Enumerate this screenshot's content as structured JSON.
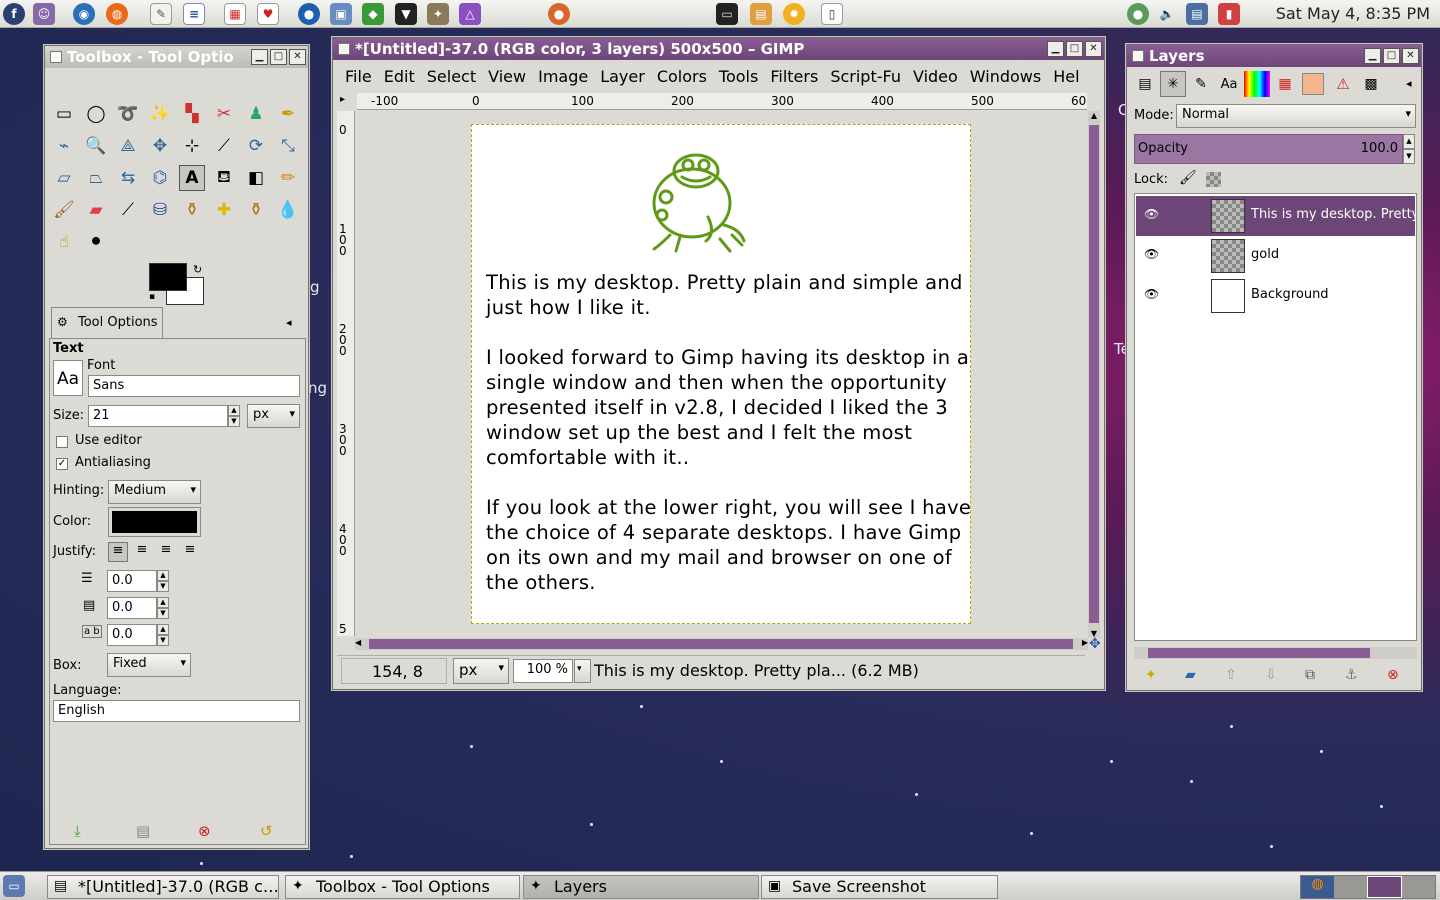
{
  "top_panel": {
    "clock": "Sat May  4,  8:35 PM"
  },
  "taskbar": {
    "items": [
      "*[Untitled]-37.0 (RGB c…",
      "Toolbox - Tool Options",
      "Layers",
      "Save Screenshot"
    ]
  },
  "toolbox": {
    "title": "Toolbox - Tool Optio",
    "tool_options_tab": "Tool Options",
    "section": "Text",
    "font_label": "Font",
    "font_preview": "Aa",
    "font_value": "Sans",
    "size_label": "Size:",
    "size_value": "21",
    "size_unit": "px",
    "use_editor": "Use editor",
    "antialiasing": "Antialiasing",
    "hinting_label": "Hinting:",
    "hinting_value": "Medium",
    "color_label": "Color:",
    "justify_label": "Justify:",
    "indent_value": "0.0",
    "line_spacing_value": "0.0",
    "letter_spacing_value": "0.0",
    "box_label": "Box:",
    "box_value": "Fixed",
    "language_label": "Language:",
    "language_value": "English"
  },
  "gimp": {
    "title": "*[Untitled]-37.0 (RGB color, 3 layers) 500x500 – GIMP",
    "menu": [
      "File",
      "Edit",
      "Select",
      "View",
      "Image",
      "Layer",
      "Colors",
      "Tools",
      "Filters",
      "Script-Fu",
      "Video",
      "Windows",
      "Hel"
    ],
    "ruler_h": [
      "-100",
      "0",
      "100",
      "200",
      "300",
      "400",
      "500",
      "60"
    ],
    "ruler_v": [
      "0",
      "1\n0\n0",
      "2\n0\n0",
      "3\n0\n0",
      "4\n0\n0",
      "5"
    ],
    "canvas_paragraphs": [
      "This is my desktop. Pretty plain and simple and just how I like it.",
      "I looked forward to Gimp having its desktop in a single window and then when the opportunity presented itself in v2.8, I decided I liked the 3 window set up the best and I felt the most comfortable with it..",
      "If you look at the lower right, you will see I have the choice of 4 separate desktops. I have Gimp on its own and my mail and browser on one of the others."
    ],
    "status_coords": "154, 8",
    "status_unit": "px",
    "status_zoom": "100 %",
    "status_message": "This is my desktop. Pretty pla... (6.2 MB)"
  },
  "layers": {
    "title": "Layers",
    "mode_label": "Mode:",
    "mode_value": "Normal",
    "opacity_label": "Opacity",
    "opacity_value": "100.0",
    "lock_label": "Lock:",
    "rows": [
      {
        "name": "This is my desktop. Pretty"
      },
      {
        "name": "gold"
      },
      {
        "name": "Background"
      }
    ]
  },
  "wallpaper": {
    "fragments": [
      "g",
      "ng",
      "Te",
      "C"
    ]
  }
}
